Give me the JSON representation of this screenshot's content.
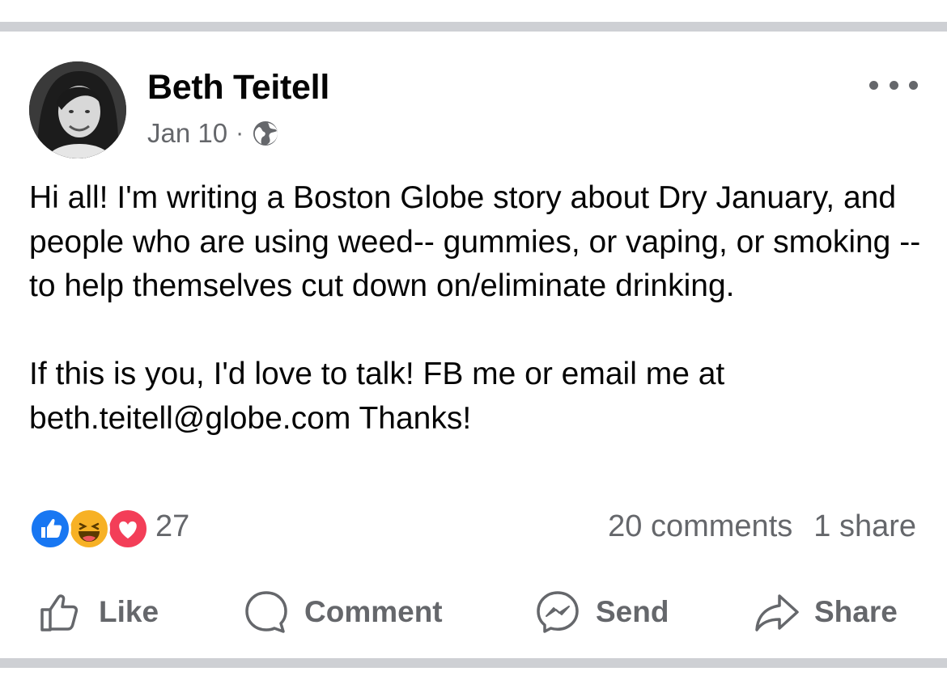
{
  "post": {
    "author": "Beth Teitell",
    "date": "Jan 10",
    "separator": "·",
    "privacy_icon": "globe-icon",
    "body": "Hi all!  I'm writing a Boston Globe story about Dry January, and people who are using weed-- gummies, or vaping, or smoking -- to help themselves cut down on/eliminate drinking.\n\nIf this is you, I'd love to talk! FB me or email me at beth.teitell@globe.com Thanks!"
  },
  "reactions": {
    "icons": [
      "like-reaction-icon",
      "haha-reaction-icon",
      "love-reaction-icon"
    ],
    "count": "27"
  },
  "stats": {
    "comments": "20 comments",
    "shares": "1 share"
  },
  "actions": {
    "like": "Like",
    "comment": "Comment",
    "send": "Send",
    "share": "Share"
  },
  "colors": {
    "divider": "#ced0d4",
    "secondary_text": "#65676b",
    "like_blue": "#1877f2",
    "haha_yellow": "#f7b125",
    "love_red": "#f33e58"
  }
}
